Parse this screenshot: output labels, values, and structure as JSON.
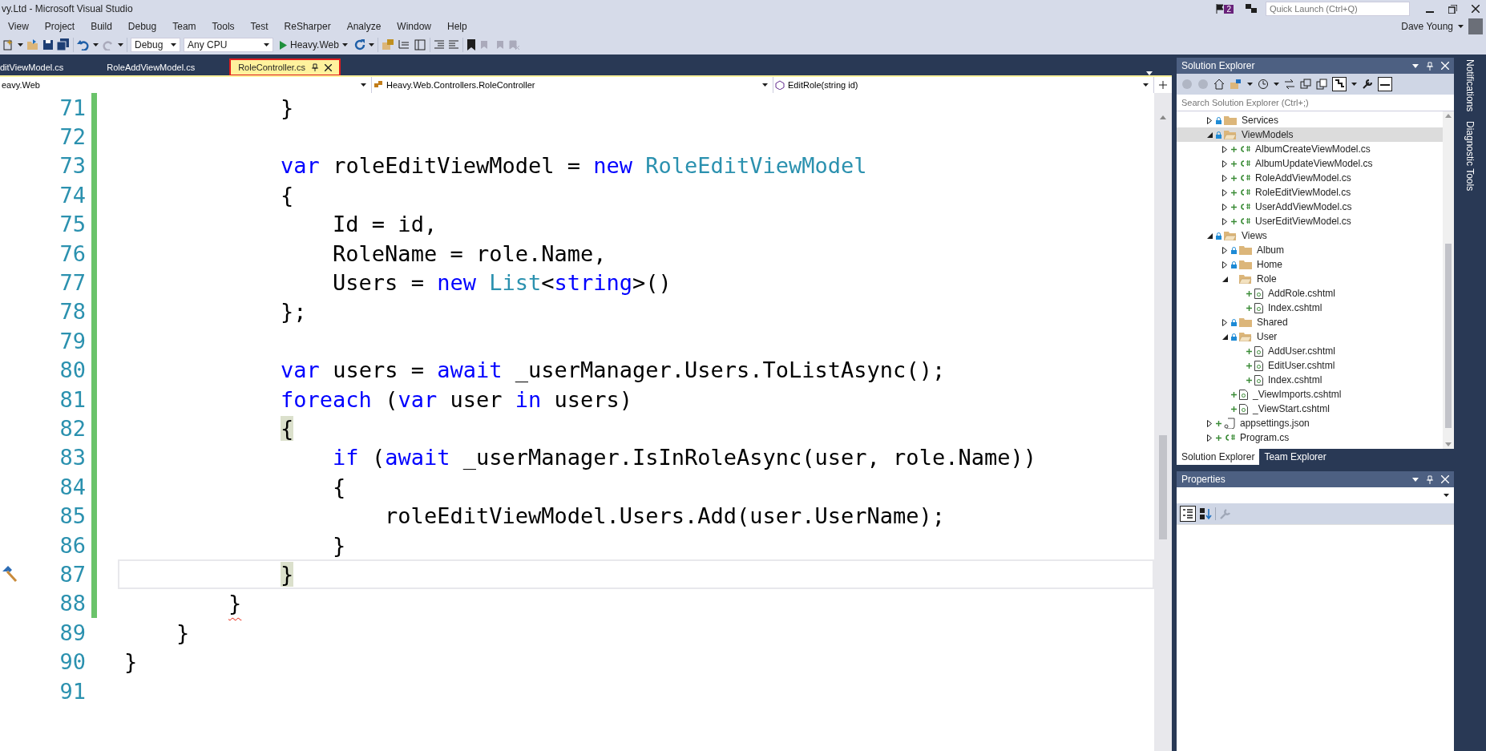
{
  "window": {
    "title": "vy.Ltd - Microsoft Visual Studio",
    "notifications_badge": "2",
    "quick_launch": {
      "placeholder": "Quick Launch (Ctrl+Q)"
    },
    "user": "Dave Young"
  },
  "menu": [
    "View",
    "Project",
    "Build",
    "Debug",
    "Team",
    "Tools",
    "Test",
    "ReSharper",
    "Analyze",
    "Window",
    "Help"
  ],
  "toolbar": {
    "configuration": "Debug",
    "platform": "Any CPU",
    "start": "Heavy.Web"
  },
  "tabs": [
    {
      "label": "ditViewModel.cs",
      "selected": false
    },
    {
      "label": "RoleAddViewModel.cs",
      "selected": false
    },
    {
      "label": "RoleController.cs",
      "selected": true
    }
  ],
  "navigation": {
    "project": "eavy.Web",
    "type": "Heavy.Web.Controllers.RoleController",
    "member": "EditRole(string id)"
  },
  "editor": {
    "lines": [
      {
        "number": "71",
        "changed": true,
        "current": false,
        "tokens": [
          {
            "text": "            }",
            "kind": "plain"
          }
        ]
      },
      {
        "number": "72",
        "changed": true,
        "current": false
      },
      {
        "number": "73",
        "changed": true,
        "current": false,
        "tokens": [
          {
            "text": "            var",
            "kind": "keyword"
          },
          {
            "text": " roleEditViewModel = ",
            "kind": "plain"
          },
          {
            "text": "new",
            "kind": "keyword"
          },
          {
            "text": " RoleEditViewModel",
            "kind": "type"
          }
        ]
      },
      {
        "number": "74",
        "changed": true,
        "current": false,
        "tokens": [
          {
            "text": "            {",
            "kind": "plain"
          }
        ]
      },
      {
        "number": "75",
        "changed": true,
        "current": false,
        "tokens": [
          {
            "text": "                Id = id,",
            "kind": "plain"
          }
        ]
      },
      {
        "number": "76",
        "changed": true,
        "current": false,
        "tokens": [
          {
            "text": "                RoleName = role.Name,",
            "kind": "plain"
          }
        ]
      },
      {
        "number": "77",
        "changed": true,
        "current": false,
        "tokens": [
          {
            "text": "                Users = ",
            "kind": "plain"
          },
          {
            "text": "new",
            "kind": "keyword"
          },
          {
            "text": " List",
            "kind": "type"
          },
          {
            "text": "<",
            "kind": "plain"
          },
          {
            "text": "string",
            "kind": "keyword"
          },
          {
            "text": ">()",
            "kind": "plain"
          }
        ]
      },
      {
        "number": "78",
        "changed": true,
        "current": false,
        "tokens": [
          {
            "text": "            };",
            "kind": "plain"
          }
        ]
      },
      {
        "number": "79",
        "changed": true,
        "current": false
      },
      {
        "number": "80",
        "changed": true,
        "current": false,
        "tokens": [
          {
            "text": "            var",
            "kind": "keyword"
          },
          {
            "text": " users = ",
            "kind": "plain"
          },
          {
            "text": "await",
            "kind": "keyword"
          },
          {
            "text": " _userManager.Users.ToListAsync();",
            "kind": "plain"
          }
        ]
      },
      {
        "number": "81",
        "changed": true,
        "current": false,
        "tokens": [
          {
            "text": "            foreach",
            "kind": "keyword"
          },
          {
            "text": " (",
            "kind": "plain"
          },
          {
            "text": "var",
            "kind": "keyword"
          },
          {
            "text": " user ",
            "kind": "plain"
          },
          {
            "text": "in",
            "kind": "keyword"
          },
          {
            "text": " users)",
            "kind": "plain"
          }
        ]
      },
      {
        "number": "82",
        "changed": true,
        "current": false,
        "tokens": [
          {
            "text": "            {",
            "kind": "brace"
          }
        ]
      },
      {
        "number": "83",
        "changed": true,
        "current": false,
        "tokens": [
          {
            "text": "                if",
            "kind": "keyword"
          },
          {
            "text": " (",
            "kind": "plain"
          },
          {
            "text": "await",
            "kind": "keyword"
          },
          {
            "text": " _userManager.IsInRoleAsync(user, role.Name))",
            "kind": "plain"
          }
        ]
      },
      {
        "number": "84",
        "changed": true,
        "current": false,
        "tokens": [
          {
            "text": "                {",
            "kind": "plain"
          }
        ]
      },
      {
        "number": "85",
        "changed": true,
        "current": false,
        "tokens": [
          {
            "text": "                    roleEditViewModel.Users.Add(user.UserName);",
            "kind": "plain"
          }
        ]
      },
      {
        "number": "86",
        "changed": true,
        "current": false,
        "tokens": [
          {
            "text": "                }",
            "kind": "plain"
          }
        ]
      },
      {
        "number": "87",
        "changed": true,
        "current": true,
        "tokens": [
          {
            "text": "            }",
            "kind": "brace"
          }
        ]
      },
      {
        "number": "88",
        "changed": true,
        "current": false,
        "tokens": [
          {
            "text": "        }",
            "kind": "error"
          }
        ]
      },
      {
        "number": "89",
        "changed": false,
        "current": false,
        "tokens": [
          {
            "text": "    }",
            "kind": "plain"
          }
        ]
      },
      {
        "number": "90",
        "changed": false,
        "current": false,
        "tokens": [
          {
            "text": "}",
            "kind": "plain"
          }
        ]
      },
      {
        "number": "91",
        "changed": false,
        "current": false
      }
    ]
  },
  "solution_explorer": {
    "title": "Solution Explorer",
    "search": {
      "placeholder": "Search Solution Explorer (Ctrl+;)"
    },
    "tree": [
      {
        "label": "Services",
        "kind": "folder",
        "locked": true,
        "expanded": false,
        "selected": false
      },
      {
        "label": "ViewModels",
        "kind": "folder",
        "locked": true,
        "expanded": true,
        "selected": true,
        "children": [
          {
            "label": "AlbumCreateViewModel.cs",
            "kind": "csharp",
            "expanded": false,
            "selected": false
          },
          {
            "label": "AlbumUpdateViewModel.cs",
            "kind": "csharp",
            "expanded": false,
            "selected": false
          },
          {
            "label": "RoleAddViewModel.cs",
            "kind": "csharp",
            "expanded": false,
            "selected": false
          },
          {
            "label": "RoleEditViewModel.cs",
            "kind": "csharp",
            "expanded": false,
            "selected": false
          },
          {
            "label": "UserAddViewModel.cs",
            "kind": "csharp",
            "expanded": false,
            "selected": false
          },
          {
            "label": "UserEditViewModel.cs",
            "kind": "csharp",
            "expanded": false,
            "selected": false
          }
        ]
      },
      {
        "label": "Views",
        "kind": "folder",
        "locked": true,
        "expanded": true,
        "selected": false,
        "children": [
          {
            "label": "Album",
            "kind": "folder",
            "locked": true,
            "expanded": false,
            "selected": false
          },
          {
            "label": "Home",
            "kind": "folder",
            "locked": true,
            "expanded": false,
            "selected": false
          },
          {
            "label": "Role",
            "kind": "folder",
            "locked": false,
            "expanded": true,
            "selected": false,
            "children": [
              {
                "label": "AddRole.cshtml",
                "kind": "razor",
                "selected": false
              },
              {
                "label": "Index.cshtml",
                "kind": "razor",
                "selected": false
              }
            ]
          },
          {
            "label": "Shared",
            "kind": "folder",
            "locked": true,
            "expanded": false,
            "selected": false
          },
          {
            "label": "User",
            "kind": "folder",
            "locked": true,
            "expanded": true,
            "selected": false,
            "children": [
              {
                "label": "AddUser.cshtml",
                "kind": "razor",
                "selected": false
              },
              {
                "label": "EditUser.cshtml",
                "kind": "razor",
                "selected": false
              },
              {
                "label": "Index.cshtml",
                "kind": "razor",
                "selected": false
              }
            ]
          },
          {
            "label": "_ViewImports.cshtml",
            "kind": "razor",
            "selected": false
          },
          {
            "label": "_ViewStart.cshtml",
            "kind": "razor",
            "selected": false
          }
        ]
      },
      {
        "label": "appsettings.json",
        "kind": "json",
        "expanded": false,
        "selected": false
      },
      {
        "label": "Program.cs",
        "kind": "csharp",
        "expanded": false,
        "selected": false
      }
    ],
    "tabs": [
      {
        "label": "Solution Explorer",
        "selected": true
      },
      {
        "label": "Team Explorer",
        "selected": false
      }
    ]
  },
  "properties": {
    "title": "Properties"
  },
  "side_tabs": [
    "Notifications",
    "Diagnostic Tools"
  ]
}
